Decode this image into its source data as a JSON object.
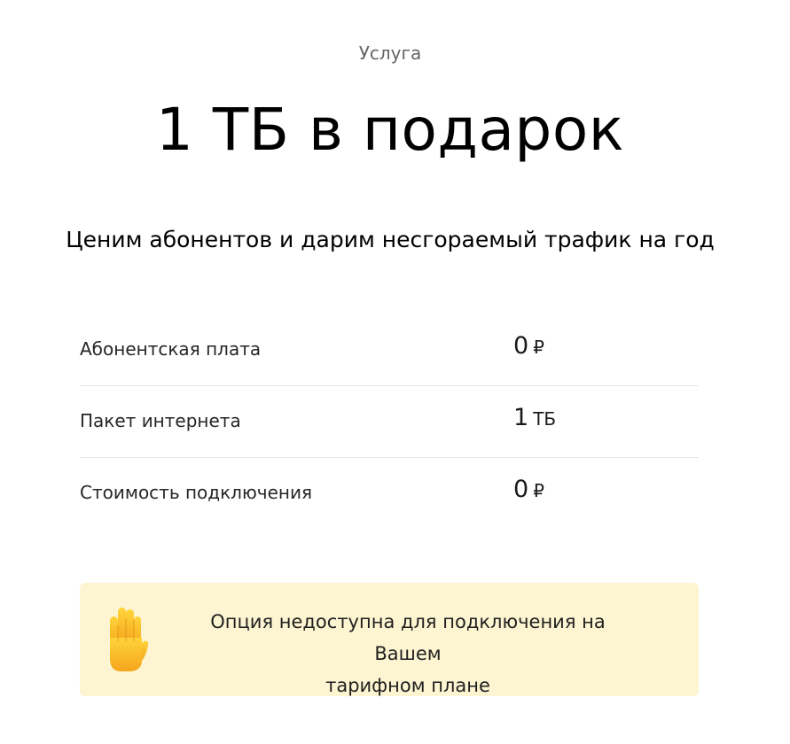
{
  "service": {
    "eyebrow": "Услуга",
    "title": "1 ТБ в подарок",
    "subtitle": "Ценим абонентов и дарим несгораемый трафик на год"
  },
  "params": [
    {
      "label": "Абонентская плата",
      "value": "0",
      "unit": "₽"
    },
    {
      "label": "Пакет интернета",
      "value": "1",
      "unit": "ТБ"
    },
    {
      "label": "Стоимость подключения",
      "value": "0",
      "unit": "₽"
    }
  ],
  "notice": {
    "icon": "raised-hand-icon",
    "line1": "Опция недоступна для подключения на Вашем",
    "line2": "тарифном плане",
    "background": "#fdf5d1"
  }
}
